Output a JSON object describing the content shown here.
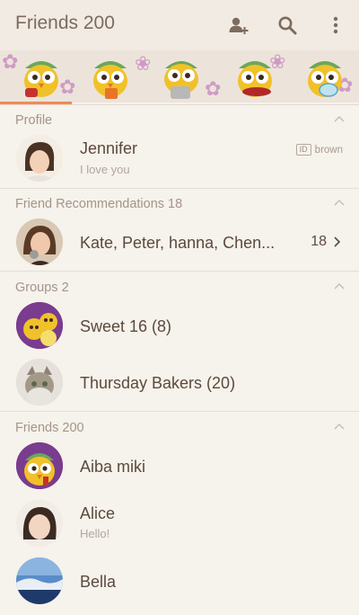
{
  "appbar": {
    "title": "Friends 200",
    "icons": [
      "add-friend-icon",
      "search-icon",
      "more-vertical-icon"
    ]
  },
  "banner": {
    "theme": "owl-mascots"
  },
  "profile": {
    "header": "Profile",
    "name": "Jennifer",
    "status": "I love you",
    "id_tag": "ID",
    "id_value": "brown"
  },
  "recommendations": {
    "header": "Friend Recommendations 18",
    "names": "Kate, Peter, hanna, Chen...",
    "count": "18"
  },
  "groups": {
    "header": "Groups 2",
    "items": [
      {
        "label": "Sweet 16 (8)"
      },
      {
        "label": "Thursday Bakers (20)"
      }
    ]
  },
  "friends": {
    "header": "Friends 200",
    "items": [
      {
        "name": "Aiba miki",
        "status": ""
      },
      {
        "name": "Alice",
        "status": "Hello!"
      },
      {
        "name": "Bella",
        "status": ""
      }
    ]
  },
  "colors": {
    "accent": "#f08a56",
    "background": "#f6f2ec",
    "text": "#5b4a3c",
    "muted": "#a39589"
  }
}
